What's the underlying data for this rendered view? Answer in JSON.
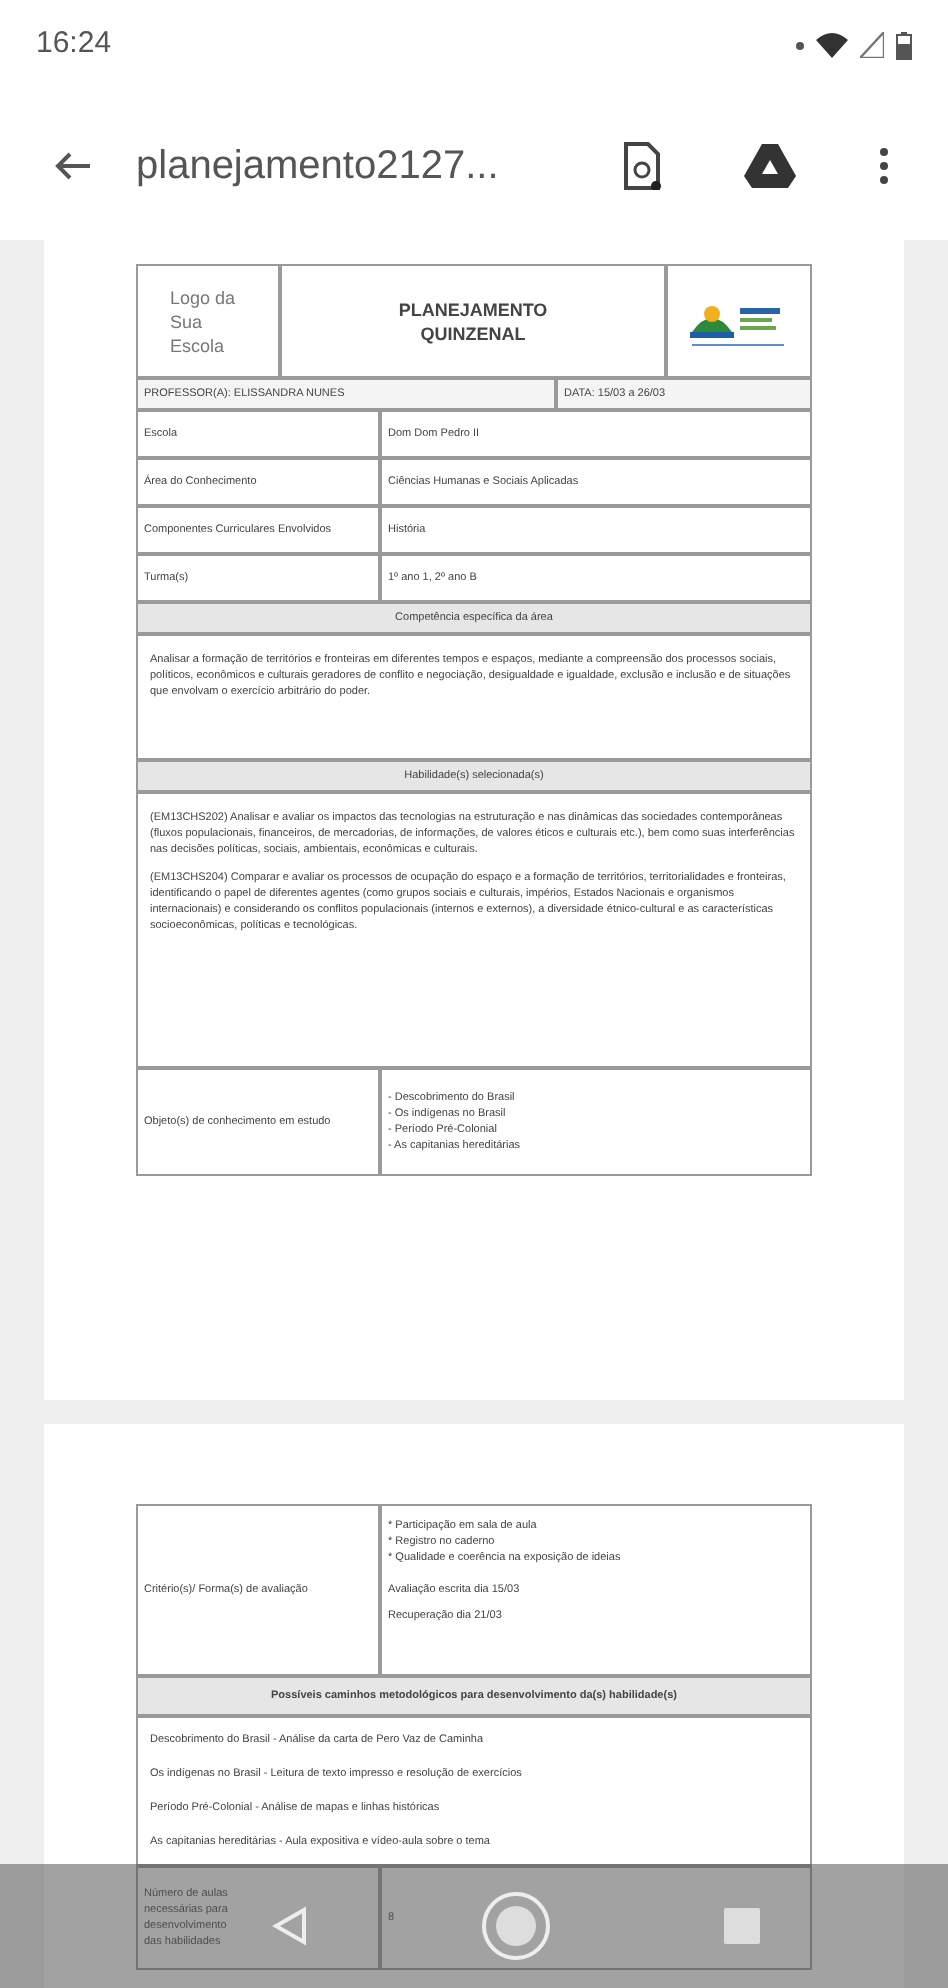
{
  "status_bar": {
    "time": "16:24"
  },
  "toolbar": {
    "title": "planejamento2127..."
  },
  "page_1": {
    "header": {
      "logo_text": "Logo da Sua Escola",
      "title": "PLANEJAMENTO QUINZENAL"
    },
    "professor": "PROFESSOR(A): ELISSANDRA NUNES",
    "date": "DATA: 15/03 a 26/03",
    "info_rows": [
      {
        "label": "Escola",
        "value": "Dom Dom Pedro II"
      },
      {
        "label": "Área do Conhecimento",
        "value": "Ciências Humanas e Sociais Aplicadas"
      },
      {
        "label": "Componentes Curriculares Envolvidos",
        "value": "História"
      },
      {
        "label": "Turma(s)",
        "value": "1º ano 1, 2º ano B"
      }
    ],
    "competencia": {
      "heading": "Competência específica da área",
      "text": "Analisar a formação de territórios e fronteiras em diferentes tempos e espaços, mediante a compreensão dos processos sociais, políticos, econômicos e culturais geradores de conflito e negociação, desigualdade e igualdade, exclusão e inclusão e de situações que envolvam o exercício arbitrário do poder."
    },
    "habilidades": {
      "heading": "Habilidade(s) selecionada(s)",
      "paragraphs": [
        "(EM13CHS202) Analisar e avaliar os impactos das tecnologias na estruturação e nas dinâmicas das sociedades contemporâneas (fluxos populacionais, financeiros, de mercadorias, de informações, de valores éticos e culturais etc.), bem como suas interferências nas decisões políticas, sociais, ambientais, econômicas e culturais.",
        "(EM13CHS204) Comparar e avaliar os processos de ocupação do espaço e a formação de territórios, territorialidades e fronteiras, identificando o papel de diferentes agentes (como grupos sociais e culturais, impérios, Estados Nacionais e organismos internacionais) e considerando os conflitos populacionais (internos e externos), a diversidade étnico-cultural e as características socioeconômicas, políticas e tecnológicas."
      ]
    },
    "objeto": {
      "label": "Objeto(s) de conhecimento em estudo",
      "items": [
        "- Descobrimento do Brasil",
        "- Os indígenas no Brasil",
        "- Período Pré-Colonial",
        "- As capitanias hereditárias"
      ]
    }
  },
  "page_2": {
    "avaliacao": {
      "label": "Critério(s)/ Forma(s) de avaliação",
      "items": [
        "* Participação em sala de aula",
        "* Registro no caderno",
        "* Qualidade e coerência na exposição de ideias"
      ],
      "notes": [
        "Avaliação escrita dia 15/03",
        "Recuperação dia 21/03"
      ]
    },
    "caminhos": {
      "heading": "Possíveis caminhos metodológicos para desenvolvimento da(s) habilidade(s)",
      "items": [
        "Descobrimento do Brasil - Análise da carta de Pero Vaz de Caminha",
        "Os indígenas no Brasil - Leitura de texto impresso e resolução de exercícios",
        "Período Pré-Colonial - Análise de mapas e linhas históricas",
        "As capitanias hereditárias - Aula expositiva e vídeo-aula sobre o tema"
      ]
    },
    "aulas": {
      "label": "Número de aulas necessárias para desenvolvimento das habilidades",
      "value": "8"
    }
  }
}
